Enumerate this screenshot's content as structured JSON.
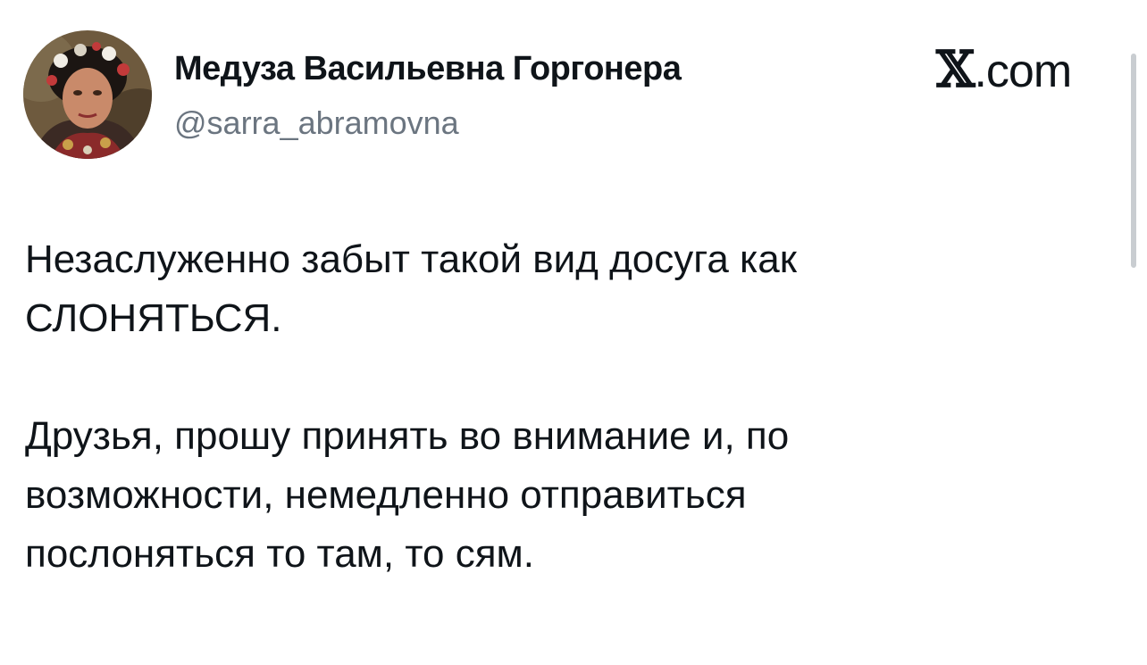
{
  "author": {
    "display_name": "Медуза Васильевна Горгонера",
    "handle": "@sarra_abramovna"
  },
  "brand": {
    "mark": "𝕏",
    "suffix": ".com"
  },
  "tweet": {
    "paragraph1_line1": "Незаслуженно забыт такой вид досуга как",
    "paragraph1_line2": "СЛОНЯТЬСЯ.",
    "paragraph2_line1": "Друзья, прошу принять во внимание и, по",
    "paragraph2_line2": "возможности, немедленно отправиться",
    "paragraph2_line3": "послоняться то там, то сям."
  },
  "icons": {
    "avatar": "avatar-photo",
    "brand": "x-logo"
  }
}
